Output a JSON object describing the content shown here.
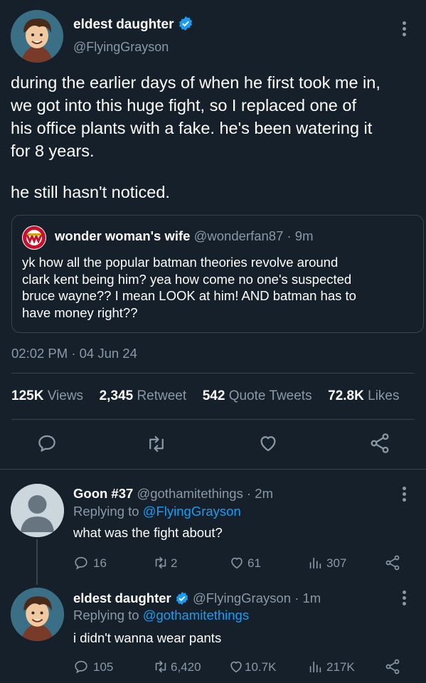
{
  "main_tweet": {
    "display_name": "eldest daughter",
    "handle": "@FlyingGrayson",
    "text_lines": [
      "during the earlier days of when he first took me in,",
      "we got into this huge fight, so I replaced one of",
      "his office plants with a fake. he's been watering it",
      "for 8 years."
    ],
    "text_last": "he still hasn't noticed.",
    "quoted": {
      "display_name": "wonder woman's wife",
      "handle_time": "@wonderfan87 · 9m",
      "text_lines": [
        "yk how all the popular batman theories revolve around",
        "clark kent being him? yea how come no one's suspected",
        "bruce wayne?? I mean LOOK at him! AND batman has to",
        "have money right??"
      ]
    },
    "timestamp": "02:02 PM · 04 Jun 24",
    "stats": {
      "views_count": "125K",
      "views_label": "Views",
      "retweets_count": "2,345",
      "retweets_label": "Retweet",
      "quotes_count": "542",
      "quotes_label": "Quote Tweets",
      "likes_count": "72.8K",
      "likes_label": "Likes"
    }
  },
  "reply1": {
    "display_name": "Goon #37",
    "handle_time": "@gothamitethings · 2m",
    "replying_prefix": "Replying to",
    "replying_to": "@FlyingGrayson",
    "text": "what was the fight about?",
    "replies": "16",
    "retweets": "2",
    "likes": "61",
    "views": "307"
  },
  "reply2": {
    "display_name": "eldest daughter",
    "handle_time": "@FlyingGrayson · 1m",
    "replying_prefix": "Replying to",
    "replying_to": "@gothamitethings",
    "text": "i didn't wanna wear pants",
    "replies": "105",
    "retweets": "6,420",
    "likes": "10.7K",
    "views": "217K"
  },
  "colors": {
    "background": "#15202b",
    "muted": "#8b98a5",
    "link": "#1d9bf0",
    "divider": "#38444d"
  },
  "icons": [
    "verified-badge-icon",
    "more-options-icon",
    "reply-icon",
    "retweet-icon",
    "like-icon",
    "share-icon",
    "views-icon"
  ]
}
